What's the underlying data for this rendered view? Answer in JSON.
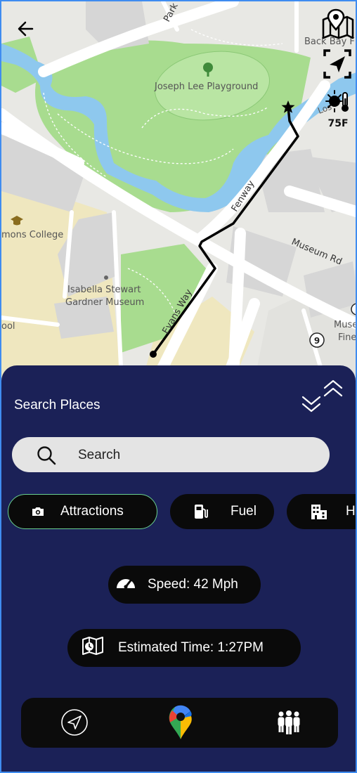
{
  "map": {
    "labels": {
      "playground": "Joseph Lee Playground",
      "museum_line1": "Isabella Stewart",
      "museum_line2": "Gardner Museum",
      "college": "mons College",
      "back_bay": "Back Bay F",
      "museum_fine_1": "Muse",
      "museum_fine_2": "Fine",
      "edge_left": "ool",
      "edge_right_top": "Los",
      "route_badge": "9"
    },
    "roads": {
      "fenway": "Fenway",
      "museum_rd": "Museum Rd",
      "evans_way": "Evans Way",
      "park": "Park"
    },
    "colors": {
      "park": "#a8dc8f",
      "water": "#8ec8ee",
      "land": "#e8e8e4",
      "block": "#d6d6d6",
      "campus": "#efe7bf",
      "route": "#000000"
    }
  },
  "controls": {
    "back_icon": "arrow-left-icon",
    "map_mode_icon": "map-pin-icon",
    "locate_icon": "navigation-arrow-icon",
    "weather_icon": "sun-thermometer-icon",
    "temperature": "75F"
  },
  "panel": {
    "title": "Search Places",
    "search": {
      "placeholder": "Search",
      "value": ""
    },
    "categories": [
      {
        "label": "Attractions",
        "icon": "camera-icon",
        "selected": true,
        "accent": "#6ad08f"
      },
      {
        "label": "Fuel",
        "icon": "fuel-pump-icon",
        "selected": false
      },
      {
        "label": "Hotels",
        "icon": "hotel-icon",
        "selected": false
      }
    ],
    "speed": "Speed: 42 Mph",
    "eta": "Estimated Time: 1:27PM"
  },
  "nav": {
    "items": [
      {
        "name": "navigate",
        "icon": "navigation-arrow-icon"
      },
      {
        "name": "maps",
        "icon": "google-maps-icon"
      },
      {
        "name": "group",
        "icon": "group-icon"
      }
    ]
  },
  "theme": {
    "panel_bg": "#1b2157",
    "pill_bg": "#0a0a0a",
    "border": "#3f8cf0"
  }
}
